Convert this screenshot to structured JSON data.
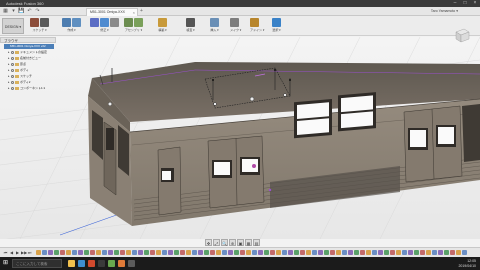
{
  "window": {
    "title": "Autodesk Fusion 360",
    "controls": [
      "–",
      "□",
      "×"
    ]
  },
  "tabbar": {
    "quick_access": [
      "▦",
      "▾",
      "💾",
      "↶",
      "↷"
    ],
    "document_tab": "M51-3001 Omiya-XXX",
    "close": "×",
    "add": "+",
    "user": "Taro Yamamoto  ▾"
  },
  "toolbar": {
    "workspace": "DESIGN ▾",
    "groups": [
      {
        "label": "スケッチ ▾",
        "colors": [
          "#8c4d3a",
          "#5a5a5a"
        ]
      },
      {
        "label": "作成 ▾",
        "colors": [
          "#4d7db0",
          "#5f8fc0"
        ]
      },
      {
        "label": "修正 ▾",
        "colors": [
          "#5b6dc4",
          "#4f8bd0",
          "#8a8a8a"
        ]
      },
      {
        "label": "アセンブリ ▾",
        "colors": [
          "#6b8c4f",
          "#7aa05a"
        ]
      },
      {
        "label": "構築 ▾",
        "colors": [
          "#c89a3a"
        ]
      },
      {
        "label": "検査 ▾",
        "colors": [
          "#555555"
        ]
      },
      {
        "label": "挿入 ▾",
        "colors": [
          "#6a8fb6"
        ]
      },
      {
        "label": "メイク ▾",
        "colors": [
          "#7e7e7e"
        ]
      },
      {
        "label": "アドイン ▾",
        "colors": [
          "#b8862c"
        ]
      },
      {
        "label": "選択 ▾",
        "colors": [
          "#3a82c8"
        ]
      }
    ]
  },
  "browser": {
    "header": "ブラウザ",
    "root": "M51-3001 Omiya-XXX v22",
    "items": [
      "ドキュメントの設定",
      "名前付きビュー",
      "原点",
      "ボディ",
      "スケッチ",
      "ボディ2",
      "コンポーネント1:1"
    ]
  },
  "viewcube": {
    "label": "FRONT"
  },
  "navbar": {
    "icons": [
      "✥",
      "⤢",
      "🔍",
      "⊕",
      "▣",
      "▦",
      "▤"
    ]
  },
  "timeline": {
    "controls": [
      "⏮",
      "◀",
      "▶",
      "▶▶",
      "⏭"
    ],
    "feature_count": 72
  },
  "taskbar": {
    "search_placeholder": "ここに入力して検索",
    "apps": [
      "#f2c14e",
      "#3e8ed0",
      "#d24a2e",
      "#3a3a3a",
      "#6aa84f",
      "#e07b39",
      "#5b5b5b"
    ],
    "clock": "12:05",
    "date": "2019/04/10"
  }
}
